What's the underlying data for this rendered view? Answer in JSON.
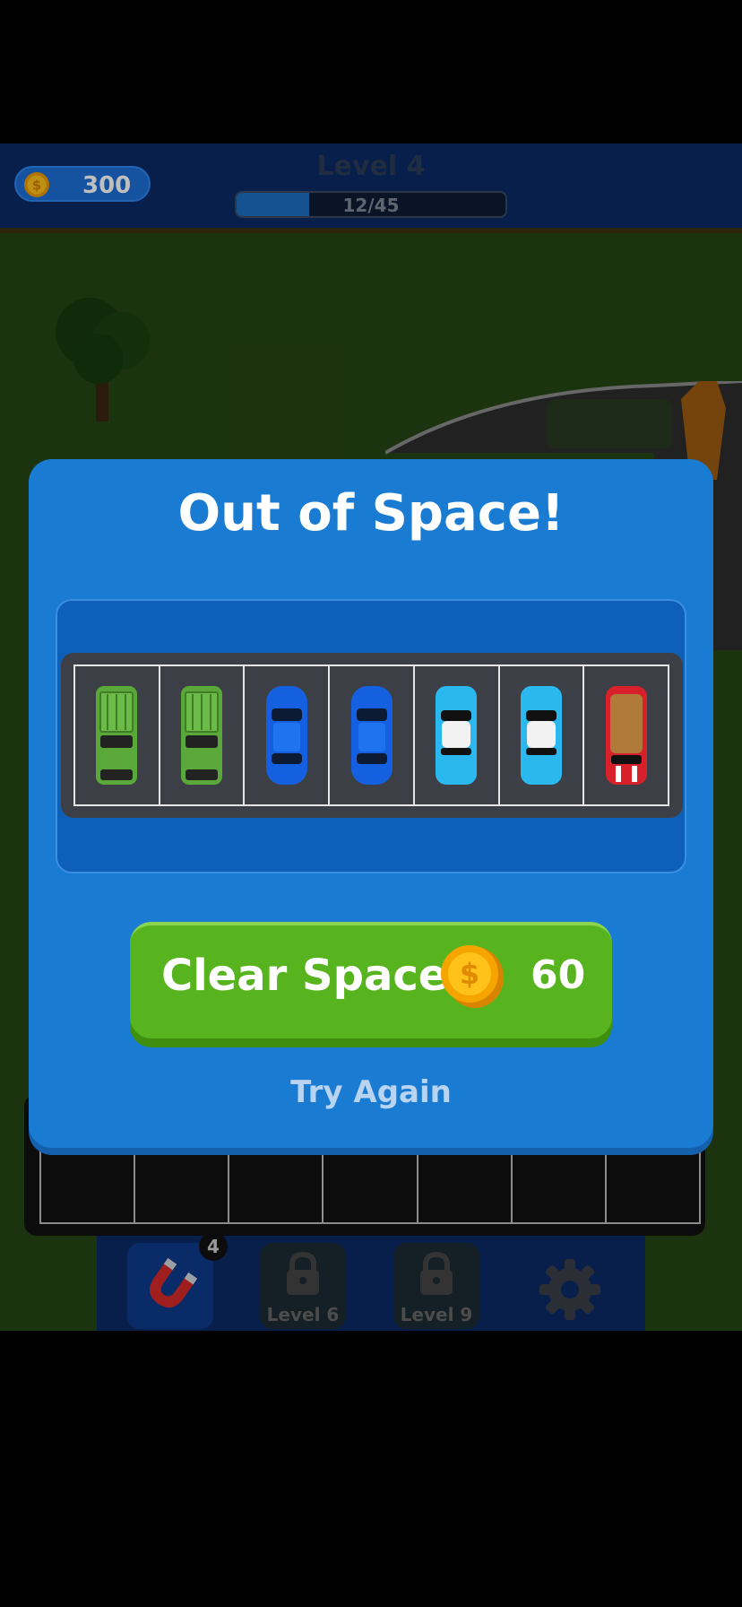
{
  "header": {
    "coins": "300",
    "level_title": "Level 4",
    "progress_text": "12/45",
    "progress_fraction": 0.27
  },
  "modal": {
    "title": "Out of Space!",
    "slots": [
      {
        "car": "green-pickup-car"
      },
      {
        "car": "green-pickup-car"
      },
      {
        "car": "blue-sedan-car"
      },
      {
        "car": "blue-sedan-car"
      },
      {
        "car": "cyan-classic-car"
      },
      {
        "car": "cyan-classic-car"
      },
      {
        "car": "red-hatchback-car"
      }
    ],
    "clear_button": {
      "label": "Clear Space",
      "cost": "60"
    },
    "try_again": "Try Again"
  },
  "toolbar": {
    "magnet_count": "4",
    "locked_1": "Level 6",
    "locked_2": "Level 9"
  },
  "colors": {
    "modal_blue": "#1a7bd2",
    "button_green": "#58b41e",
    "header_navy": "#0b2a66",
    "coin_gold": "#f5b400"
  }
}
